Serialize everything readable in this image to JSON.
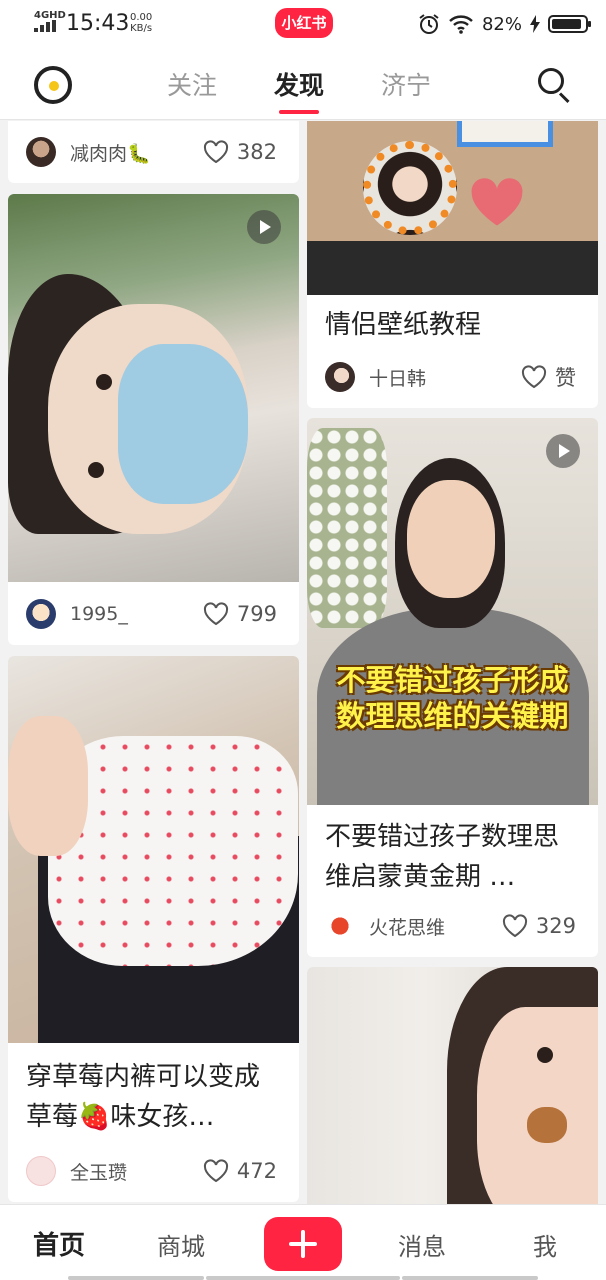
{
  "status_bar": {
    "network": "4GHD",
    "time": "15:43",
    "speed_value": "0.00",
    "speed_unit": "KB/s",
    "app_badge": "小红书",
    "battery": "82%"
  },
  "top_nav": {
    "tabs": [
      {
        "label": "关注",
        "active": false
      },
      {
        "label": "发现",
        "active": true
      },
      {
        "label": "济宁",
        "active": false
      }
    ],
    "icons": {
      "logo": "camera-lens-icon",
      "search": "search-icon"
    }
  },
  "feed": {
    "left": [
      {
        "author": "减肉肉🐛",
        "likes": "382"
      },
      {
        "author": "1995_",
        "likes": "799",
        "is_video": true
      },
      {
        "title": "穿草莓内裤可以变成草莓🍓味女孩…",
        "author": "全玉瓒",
        "likes": "472"
      }
    ],
    "right": [
      {
        "title": "情侣壁纸教程",
        "author": "十日韩",
        "likes": "赞"
      },
      {
        "cover_caption_line1": "不要错过孩子形成",
        "cover_caption_line2": "数理思维的关键期",
        "title": "不要错过孩子数理思维启蒙黄金期 …",
        "author": "火花思维",
        "likes": "329",
        "is_video": true
      },
      {
        "title": ""
      }
    ]
  },
  "bottom_nav": {
    "items": [
      "首页",
      "商城",
      "消息",
      "我"
    ],
    "active": "首页",
    "publish_icon": "plus-icon"
  },
  "colors": {
    "brand": "#ff2442",
    "accent_logo": "#f5c518"
  }
}
